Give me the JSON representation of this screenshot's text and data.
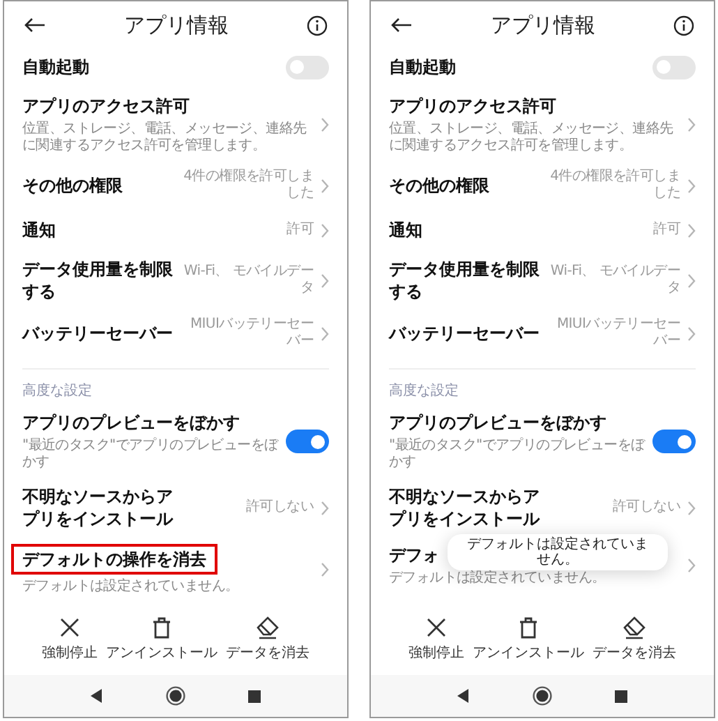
{
  "phones": [
    {
      "title": "アプリ情報",
      "sections": [
        {
          "rows": [
            {
              "kind": "toggle",
              "title": "自動起動",
              "on": false
            },
            {
              "kind": "link",
              "title": "アプリのアクセス許可",
              "subtitle": "位置、ストレージ、電話、メッセージ、連絡先に関連するアクセス許可を管理します。"
            },
            {
              "kind": "link",
              "title": "その他の権限",
              "value": "4件の権限を許可しました"
            },
            {
              "kind": "link",
              "title": "通知",
              "value": "許可"
            },
            {
              "kind": "link",
              "title": "データ使用量を制限する",
              "value": "Wi-Fi、 モバイルデータ"
            },
            {
              "kind": "link",
              "title": "バッテリーセーバー",
              "value": "MIUIバッテリーセーバー"
            }
          ]
        },
        {
          "heading": "高度な設定",
          "rows": [
            {
              "kind": "toggle",
              "title": "アプリのプレビューをぼかす",
              "subtitle": "\"最近のタスク\"でアプリのプレビューをぼかす",
              "on": true
            },
            {
              "kind": "link",
              "title": "不明なソースからアプリをインストール",
              "value": "許可しない"
            },
            {
              "kind": "link",
              "title": "デフォルトの操作を消去",
              "subtitle": "デフォルトは設定されていません。",
              "highlighted": true
            }
          ]
        }
      ],
      "actions": [
        {
          "kind": "close",
          "label": "強制停止"
        },
        {
          "kind": "trash",
          "label": "アンインストール"
        },
        {
          "kind": "eraser",
          "label": "データを消去"
        }
      ]
    },
    {
      "title": "アプリ情報",
      "sections": [
        {
          "rows": [
            {
              "kind": "toggle",
              "title": "自動起動",
              "on": false
            },
            {
              "kind": "link",
              "title": "アプリのアクセス許可",
              "subtitle": "位置、ストレージ、電話、メッセージ、連絡先に関連するアクセス許可を管理します。"
            },
            {
              "kind": "link",
              "title": "その他の権限",
              "value": "4件の権限を許可しました"
            },
            {
              "kind": "link",
              "title": "通知",
              "value": "許可"
            },
            {
              "kind": "link",
              "title": "データ使用量を制限する",
              "value": "Wi-Fi、 モバイルデータ"
            },
            {
              "kind": "link",
              "title": "バッテリーセーバー",
              "value": "MIUIバッテリーセーバー"
            }
          ]
        },
        {
          "heading": "高度な設定",
          "rows": [
            {
              "kind": "toggle",
              "title": "アプリのプレビューをぼかす",
              "subtitle": "\"最近のタスク\"でアプリのプレビューをぼかす",
              "on": true
            },
            {
              "kind": "link",
              "title": "不明なソースからアプリをインストール",
              "value": "許可しない"
            },
            {
              "kind": "link",
              "title": "デフォ",
              "subtitle": "デフォルトは設定されていません。",
              "highlighted": false
            }
          ]
        }
      ],
      "actions": [
        {
          "kind": "close",
          "label": "強制停止"
        },
        {
          "kind": "trash",
          "label": "アンインストール"
        },
        {
          "kind": "eraser",
          "label": "データを消去"
        }
      ],
      "toast": "デフォルトは設定されていません。"
    }
  ]
}
